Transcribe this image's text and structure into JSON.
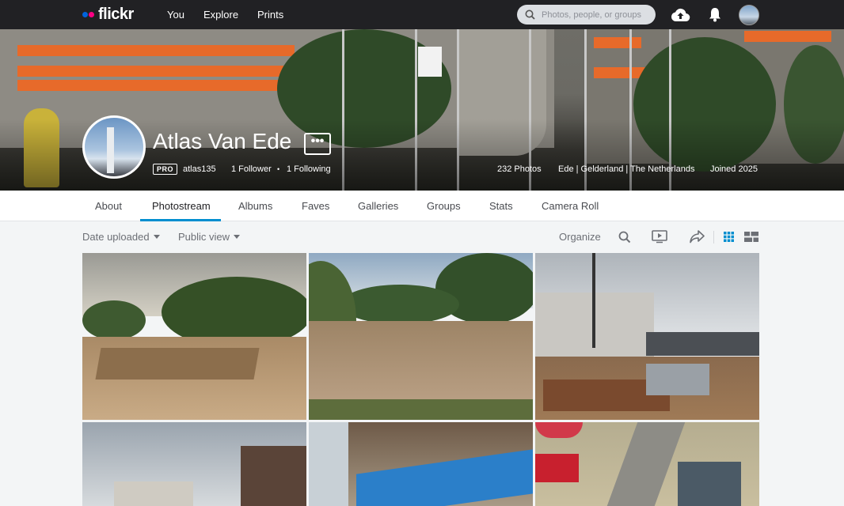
{
  "brand": {
    "name": "flickr",
    "blue": "#0063dc",
    "pink": "#ff0084"
  },
  "nav": {
    "links": [
      "You",
      "Explore",
      "Prints"
    ],
    "search_placeholder": "Photos, people, or groups",
    "upload_icon": "cloud-upload-icon",
    "notifications_icon": "bell-icon"
  },
  "profile": {
    "name": "Atlas Van Ede",
    "more_label": "•••",
    "badge": "PRO",
    "username": "atlas135",
    "followers": "1 Follower",
    "separator": "•",
    "following": "1 Following",
    "photos": "232 Photos",
    "location": "Ede | Gelderland | The Netherlands",
    "joined": "Joined 2025"
  },
  "tabs": {
    "items": [
      "About",
      "Photostream",
      "Albums",
      "Faves",
      "Galleries",
      "Groups",
      "Stats",
      "Camera Roll"
    ],
    "active": "Photostream"
  },
  "toolbar": {
    "sort": "Date uploaded",
    "visibility": "Public view",
    "organize": "Organize",
    "icons": [
      "search-icon",
      "slideshow-icon",
      "share-icon",
      "grid-view-icon",
      "justified-view-icon"
    ]
  },
  "photos": [
    {
      "subject": "construction site with trees"
    },
    {
      "subject": "construction site with trees"
    },
    {
      "subject": "building under construction"
    },
    {
      "subject": "buildings and sky"
    },
    {
      "subject": "blue train at station"
    },
    {
      "subject": "path with people and flags"
    }
  ],
  "colors": {
    "accent": "#008ecf",
    "topbar": "#212124"
  }
}
